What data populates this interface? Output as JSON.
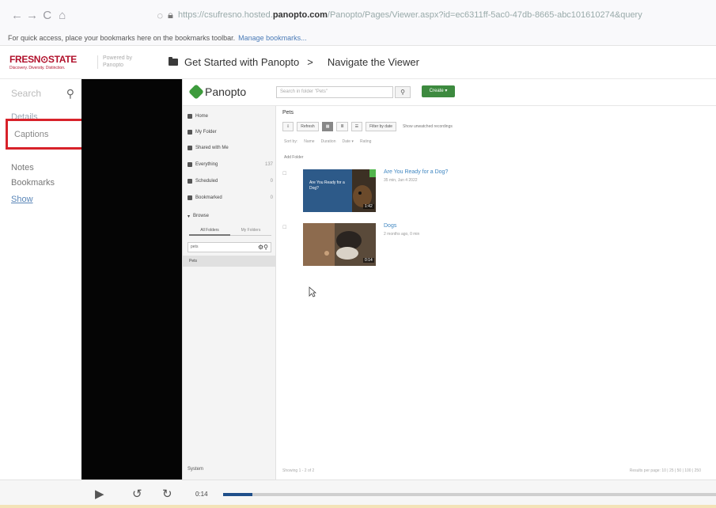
{
  "browser": {
    "back_icon": "←",
    "forward_icon": "→",
    "reload_icon": "C",
    "home_icon": "⌂",
    "url_prefix": "https://csufresno.hosted.",
    "url_domain": "panopto.com",
    "url_path": "/Panopto/Pages/Viewer.aspx?id=ec6311ff-5ac0-47db-8665-abc101610274&query",
    "bookmarks_text": "For quick access, place your bookmarks here on the bookmarks toolbar.",
    "bookmarks_link": "Manage bookmarks..."
  },
  "viewer": {
    "brand_name": "FRESN⊙STATE",
    "brand_tag": "Discovery. Diversity. Distinction.",
    "powered_by": "Powered by Panopto",
    "breadcrumb": [
      "Get Started with Panopto",
      "Navigate the Viewer"
    ],
    "breadcrumb_sep": ">"
  },
  "sidebar": {
    "search_placeholder": "Search",
    "details_label": "Details",
    "captions_label": "Captions",
    "notes_label": "Notes",
    "bookmarks_label": "Bookmarks",
    "show_label": "Show"
  },
  "panopto": {
    "logo": "Panopto",
    "search_placeholder": "Search in folder \"Pets\"",
    "create_label": "Create ▾",
    "nav": [
      {
        "label": "Home",
        "count": ""
      },
      {
        "label": "My Folder",
        "count": ""
      },
      {
        "label": "Shared with Me",
        "count": ""
      },
      {
        "label": "Everything",
        "count": "137"
      },
      {
        "label": "Scheduled",
        "count": "0"
      },
      {
        "label": "Bookmarked",
        "count": "0"
      }
    ],
    "browse_label": "Browse",
    "browse_tabs": [
      "All Folders",
      "My Folders"
    ],
    "folder_filter": "pets",
    "folder_selected": "Pets",
    "system_label": "System",
    "folder_title": "Pets",
    "toolbar": {
      "refresh": "Refresh",
      "filter": "Filter by date",
      "show_unwatched": "Show unwatched recordings"
    },
    "sort": [
      "Sort by:",
      "Name",
      "Duration",
      "Date ▾",
      "Rating"
    ],
    "add_folder": "Add Folder",
    "sessions": [
      {
        "title": "Are You Ready for a Dog?",
        "meta": "35 min, Jan 4 2022",
        "thumb_text": "Are You Ready for a Dog?",
        "duration": "1:42"
      },
      {
        "title": "Dogs",
        "meta": "2 months ago, 0 min",
        "thumb_text": "",
        "duration": "0:14"
      }
    ],
    "footer_left": "Showing 1 - 2 of 2",
    "footer_right": "Results per page: 10 | 25 | 50 | 100 | 250"
  },
  "player": {
    "play_icon": "▶",
    "rewind_icon": "↺",
    "forward_icon": "↻",
    "time": "0:14",
    "progress": 0.06
  }
}
